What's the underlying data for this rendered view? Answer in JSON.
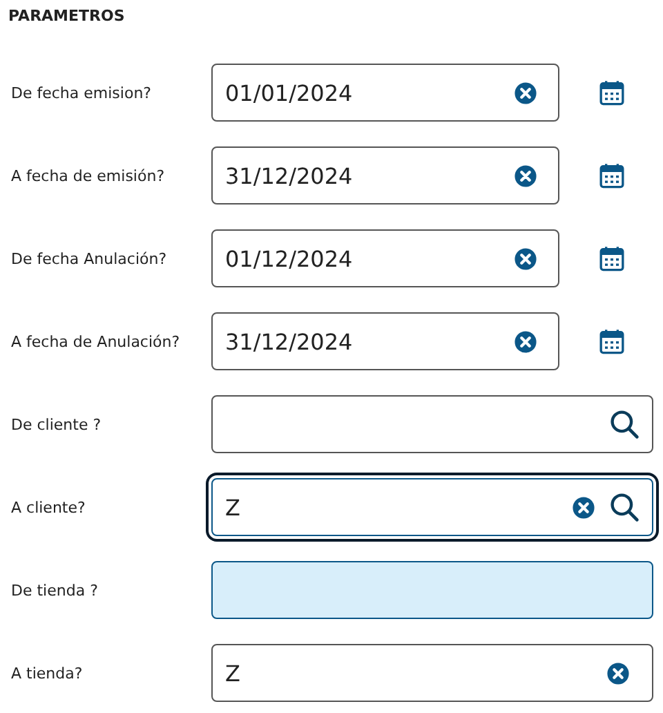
{
  "section_title": "PARAMETROS",
  "fields": [
    {
      "label": "De fecha emision?",
      "kind": "date",
      "value": "01/01/2024",
      "clear_button": true,
      "search_button": false,
      "focused": false,
      "highlighted": false
    },
    {
      "label": "A fecha de emisión?",
      "kind": "date",
      "value": "31/12/2024",
      "clear_button": true,
      "search_button": false,
      "focused": false,
      "highlighted": false
    },
    {
      "label": "De fecha Anulación?",
      "kind": "date",
      "value": "01/12/2024",
      "clear_button": true,
      "search_button": false,
      "focused": false,
      "highlighted": false
    },
    {
      "label": "A fecha de Anulación?",
      "kind": "date",
      "value": "31/12/2024",
      "clear_button": true,
      "search_button": false,
      "focused": false,
      "highlighted": false
    },
    {
      "label": "De cliente ?",
      "kind": "lookup",
      "clear_button": false,
      "search_button": true,
      "focused": false,
      "highlighted": false
    },
    {
      "label": "A cliente?",
      "kind": "lookup",
      "value": "Z",
      "clear_button": true,
      "search_button": true,
      "focused": true,
      "highlighted": false
    },
    {
      "label": "De tienda ?",
      "kind": "lookup",
      "clear_button": false,
      "search_button": false,
      "focused": false,
      "highlighted": true
    },
    {
      "label": "A tienda?",
      "kind": "lookup",
      "value": "Z",
      "clear_button": true,
      "search_button": false,
      "focused": false,
      "highlighted": false
    }
  ]
}
